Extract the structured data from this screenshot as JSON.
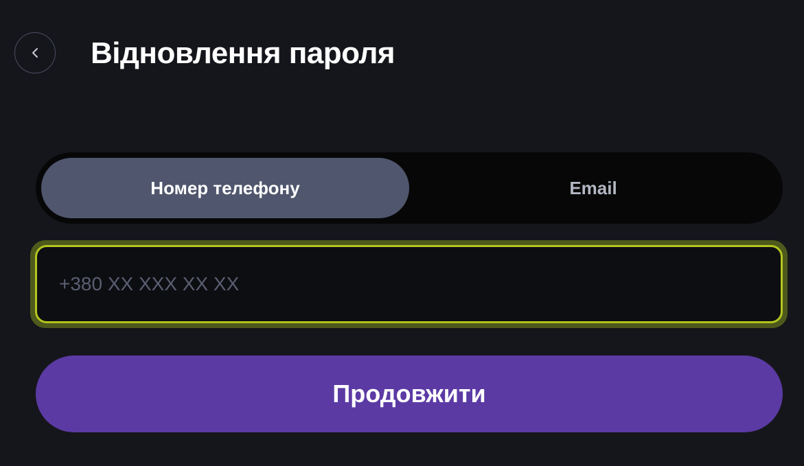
{
  "header": {
    "back_icon": "chevron-left-icon",
    "title": "Відновлення пароля"
  },
  "method_toggle": {
    "tabs": [
      {
        "label": "Номер телефону",
        "selected": true
      },
      {
        "label": "Email",
        "selected": false
      }
    ]
  },
  "phone_field": {
    "value": "",
    "placeholder": "+380 XX XXX XX XX"
  },
  "actions": {
    "continue_label": "Продовжити"
  },
  "colors": {
    "background": "#15161b",
    "toggle_track": "#070708",
    "tab_selected": "#4f566d",
    "input_focus_border": "#b4c61e",
    "input_focus_glow": "#4e5a1c",
    "primary_button": "#5b3aa4"
  }
}
